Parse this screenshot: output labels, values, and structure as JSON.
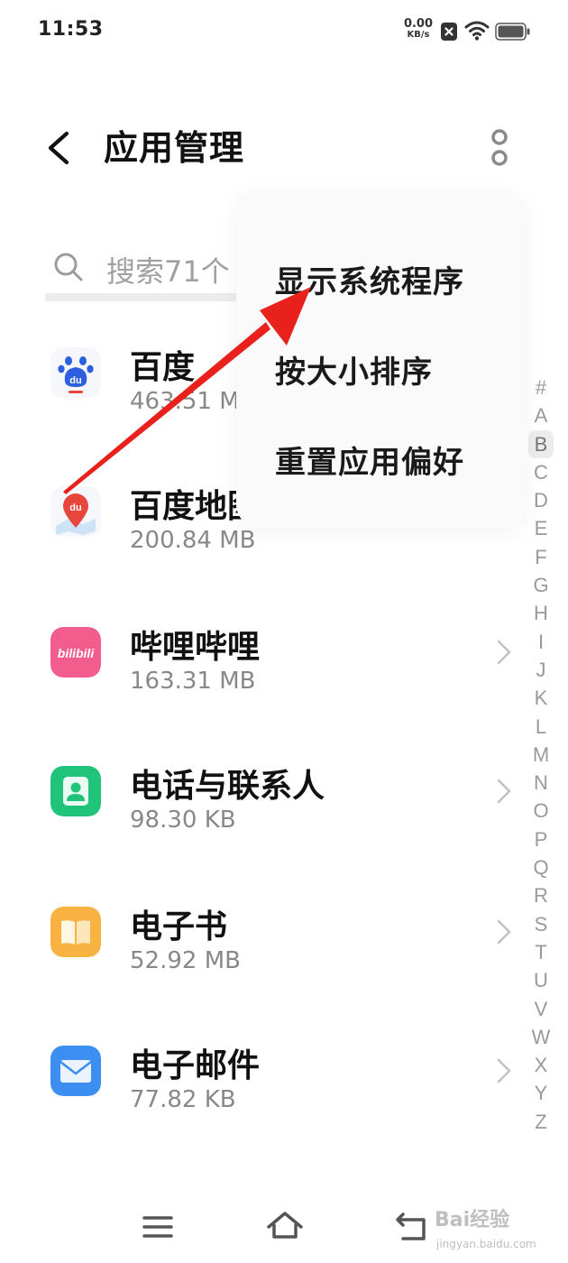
{
  "status_bar": {
    "time": "11:53",
    "net_speed_value": "0.00",
    "net_speed_unit": "KB/s",
    "icons": [
      "notification-x-icon",
      "wifi-icon",
      "battery-icon"
    ]
  },
  "header": {
    "title": "应用管理",
    "back_icon": "chevron-left-icon",
    "more_icon": "more-vertical-icon"
  },
  "search": {
    "placeholder": "搜索71个"
  },
  "popup_menu": {
    "items": [
      {
        "label": "显示系统程序"
      },
      {
        "label": "按大小排序"
      },
      {
        "label": "重置应用偏好"
      }
    ]
  },
  "apps": [
    {
      "name": "百度",
      "size": "463.51 MB",
      "icon": "baidu-icon",
      "color": "#2e5fe0"
    },
    {
      "name": "百度地图",
      "size": "200.84 MB",
      "icon": "baidu-map-icon",
      "color": "#e8453c"
    },
    {
      "name": "哔哩哔哩",
      "size": "163.31 MB",
      "icon": "bilibili-icon",
      "color": "#f25d8e"
    },
    {
      "name": "电话与联系人",
      "size": "98.30 KB",
      "icon": "contacts-icon",
      "color": "#1fc47a"
    },
    {
      "name": "电子书",
      "size": "52.92 MB",
      "icon": "ebook-icon",
      "color": "#f7b241"
    },
    {
      "name": "电子邮件",
      "size": "77.82 KB",
      "icon": "email-icon",
      "color": "#3c8ef0"
    }
  ],
  "index_rail": {
    "letters": [
      "#",
      "A",
      "B",
      "C",
      "D",
      "E",
      "F",
      "G",
      "H",
      "I",
      "J",
      "K",
      "L",
      "M",
      "N",
      "O",
      "P",
      "Q",
      "R",
      "S",
      "T",
      "U",
      "V",
      "W",
      "X",
      "Y",
      "Z"
    ],
    "active": "B"
  },
  "nav_bar": {
    "icons": [
      "menu-icon",
      "home-icon",
      "back-icon"
    ]
  },
  "annotation": {
    "arrow_color": "#e8211d"
  },
  "watermark": {
    "main": "Bai经验",
    "sub": "jingyan.baidu.com"
  }
}
